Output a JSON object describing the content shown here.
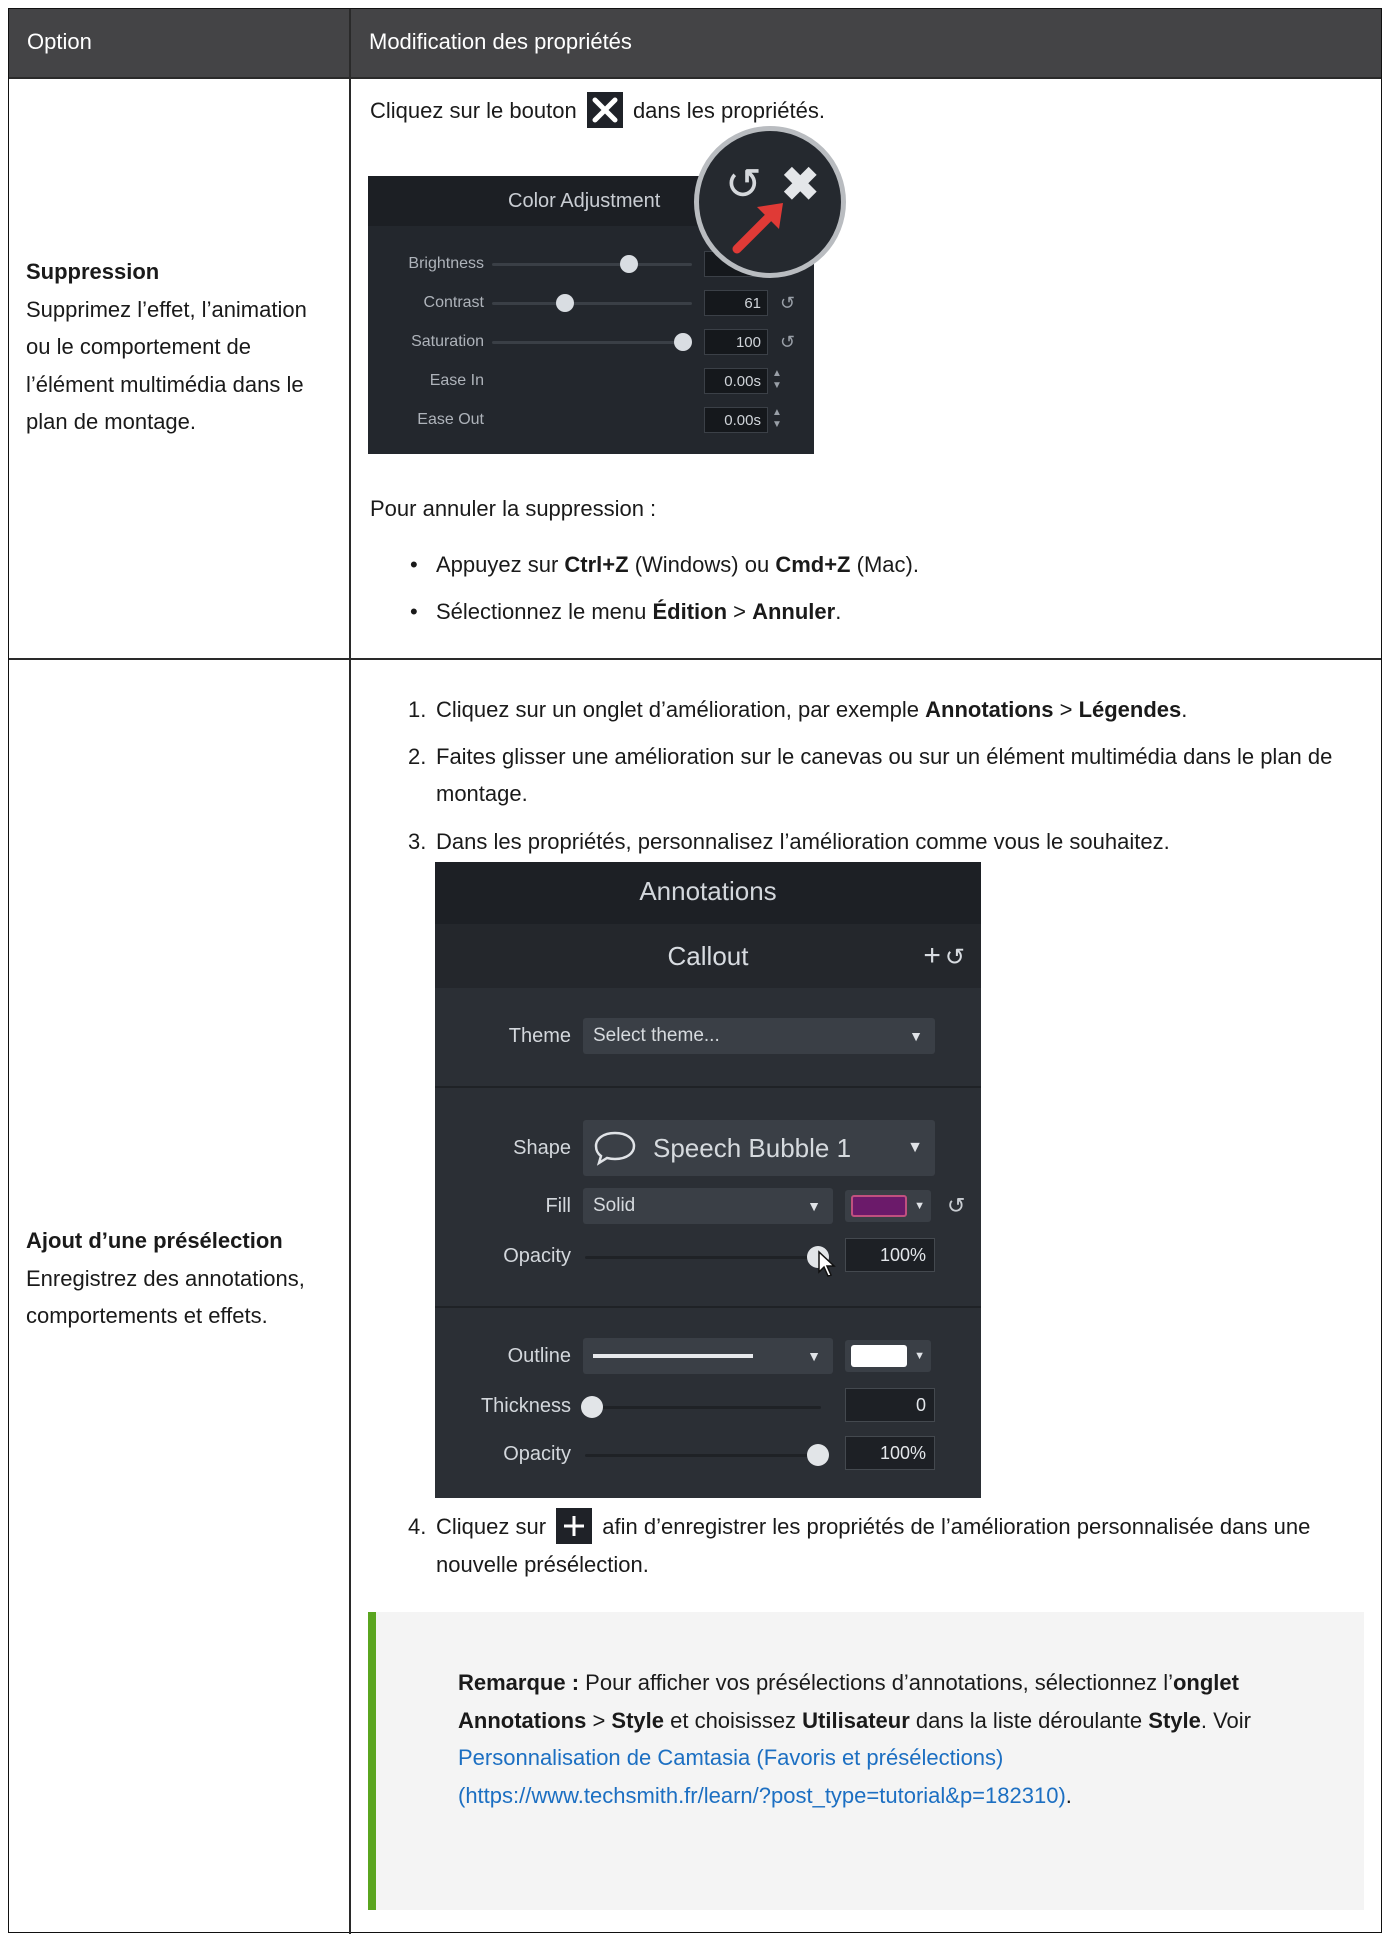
{
  "header": {
    "col1": "Option",
    "col2": "Modification des propriétés"
  },
  "row1": {
    "title": "Suppression",
    "description": "Supprimez l’effet, l’animation ou le comportement de l’élément multimédia dans le plan de montage.",
    "intro_before": "Cliquez sur le bouton",
    "intro_after": "dans les propriétés.",
    "panel": {
      "title": "Color Adjustment",
      "rows": [
        {
          "label": "Brightness",
          "value": "",
          "level": 0.56,
          "kind": "slider"
        },
        {
          "label": "Contrast",
          "value": "61",
          "level": 0.3,
          "kind": "slider"
        },
        {
          "label": "Saturation",
          "value": "100",
          "level": 1.0,
          "kind": "slider"
        },
        {
          "label": "Ease In",
          "value": "0.00s",
          "kind": "spin"
        },
        {
          "label": "Ease Out",
          "value": "0.00s",
          "kind": "spin"
        }
      ]
    },
    "undo_intro": "Pour annuler la suppression :",
    "bullet1": {
      "a": "Appuyez sur ",
      "b": "Ctrl+Z",
      "c": " (Windows) ou ",
      "d": "Cmd+Z",
      "e": " (Mac)."
    },
    "bullet2": {
      "a": "Sélectionnez le menu ",
      "b": "Édition",
      "c": " > ",
      "d": "Annuler",
      "e": "."
    }
  },
  "row2": {
    "title": "Ajout d’une présélection",
    "description": "Enregistrez des annotations, comportements et effets.",
    "step1": {
      "n": "1.",
      "a": "Cliquez sur un onglet d’amélioration, par exemple ",
      "b": "Annotations",
      "c": " > ",
      "d": "Légendes",
      "e": "."
    },
    "step2": {
      "n": "2.",
      "text": "Faites glisser une amélioration sur le canevas ou sur un élément multimédia dans le plan de montage."
    },
    "step3": {
      "n": "3.",
      "text": "Dans les propriétés, personnalisez l’amélioration comme vous le souhaitez."
    },
    "step4": {
      "n": "4.",
      "a": "Cliquez sur",
      "b": "afin d’enregistrer les propriétés de l’amélioration personnalisée dans une nouvelle présélection."
    },
    "panel": {
      "tab": "Annotations",
      "section": "Callout",
      "theme_label": "Theme",
      "theme_value": "Select theme...",
      "shape_label": "Shape",
      "shape_value": "Speech Bubble 1",
      "fill_label": "Fill",
      "fill_value": "Solid",
      "fill_color": "#6b1a6a",
      "opacity_label": "Opacity",
      "opacity_value": "100%",
      "opacity_level": 1.0,
      "outline_label": "Outline",
      "outline_color": "#ffffff",
      "thickness_label": "Thickness",
      "thickness_value": "0",
      "thickness_level": 0.0,
      "opacity2_label": "Opacity",
      "opacity2_value": "100%",
      "opacity2_level": 1.0
    },
    "note": {
      "label": "Remarque :",
      "t1": " Pour afficher vos présélections d’annotations, sélectionnez l’",
      "b1": "onglet Annotations",
      "t2": " > ",
      "b2": "Style",
      "t3": " et choisissez ",
      "b3": "Utilisateur",
      "t4": " dans la liste déroulante ",
      "b4": "Style",
      "t5": ". Voir ",
      "link": "Personnalisation de Camtasia (Favoris et présélections) (https://www.techsmith.fr/learn/?post_type=tutorial&p=182310)",
      "t6": "."
    }
  },
  "colors": {
    "header_bg": "#444446",
    "note_accent": "#5aa51f",
    "link": "#1c6fc2"
  }
}
